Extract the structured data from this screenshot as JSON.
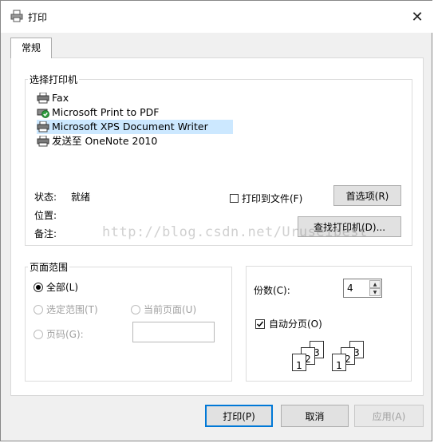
{
  "window": {
    "title": "打印",
    "close_glyph": "✕"
  },
  "tabs": [
    {
      "label": "常规"
    }
  ],
  "select_printer": {
    "legend": "选择打印机",
    "printers": [
      {
        "name": "Fax",
        "icon": "fax-printer-icon"
      },
      {
        "name": "Microsoft Print to PDF",
        "icon": "default-printer-icon"
      },
      {
        "name": "Microsoft XPS Document Writer",
        "icon": "printer-icon",
        "selected": true
      },
      {
        "name": "发送至 OneNote 2010",
        "icon": "printer-icon"
      }
    ],
    "status_label": "状态:",
    "status_value": "就绪",
    "location_label": "位置:",
    "comment_label": "备注:",
    "print_to_file": "打印到文件(F)",
    "preferences_button": "首选项(R)",
    "find_printer_button": "查找打印机(D)..."
  },
  "watermark": "http://blog.csdn.net/Uruseibest",
  "page_range": {
    "legend": "页面范围",
    "all": "全部(L)",
    "selection": "选定范围(T)",
    "current_page": "当前页面(U)",
    "pages": "页码(G):"
  },
  "copies": {
    "label": "份数(C):",
    "value": "4",
    "collate": "自动分页(O)",
    "collate_checked": true
  },
  "collate_preview": {
    "sheets": [
      "1",
      "2",
      "3"
    ]
  },
  "footer": {
    "print_button": "打印(P)",
    "cancel_button": "取消",
    "apply_button": "应用(A)"
  }
}
